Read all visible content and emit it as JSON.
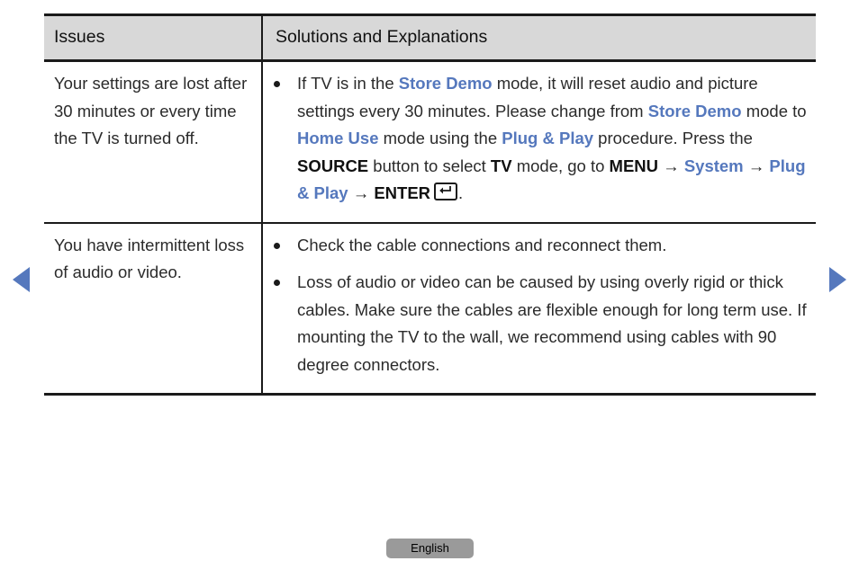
{
  "page": {
    "language_label": "English"
  },
  "navigation": {
    "prev_label": "previous-page",
    "next_label": "next-page"
  },
  "table": {
    "headers": {
      "issues": "Issues",
      "solutions": "Solutions and Explanations"
    },
    "rows": [
      {
        "issue": "Your settings are lost after 30 minutes or every time the TV is turned off.",
        "bullets": [
          {
            "segments": [
              {
                "text": "If TV is in the ",
                "style": "plain"
              },
              {
                "text": "Store Demo",
                "style": "blue"
              },
              {
                "text": " mode, it will reset audio and picture settings every 30 minutes. Please change from ",
                "style": "plain"
              },
              {
                "text": "Store Demo",
                "style": "blue"
              },
              {
                "text": " mode to ",
                "style": "plain"
              },
              {
                "text": "Home Use",
                "style": "blue"
              },
              {
                "text": " mode using the ",
                "style": "plain"
              },
              {
                "text": "Plug & Play",
                "style": "blue"
              },
              {
                "text": " procedure. Press the ",
                "style": "plain"
              },
              {
                "text": "SOURCE",
                "style": "strong"
              },
              {
                "text": " button to select ",
                "style": "plain"
              },
              {
                "text": "TV",
                "style": "strong"
              },
              {
                "text": " mode, go to ",
                "style": "plain"
              },
              {
                "text": "MENU",
                "style": "strong"
              },
              {
                "text": " → ",
                "style": "arrow"
              },
              {
                "text": "System",
                "style": "blue"
              },
              {
                "text": " → ",
                "style": "arrow"
              },
              {
                "text": "Plug & Play",
                "style": "blue"
              },
              {
                "text": " → ",
                "style": "arrow"
              },
              {
                "text": "ENTER",
                "style": "strong"
              },
              {
                "text": "",
                "style": "enter-key-icon"
              },
              {
                "text": ".",
                "style": "plain"
              }
            ]
          }
        ]
      },
      {
        "issue": "You have intermittent loss of audio or video.",
        "bullets": [
          {
            "segments": [
              {
                "text": "Check the cable connections and reconnect them.",
                "style": "plain"
              }
            ]
          },
          {
            "segments": [
              {
                "text": "Loss of audio or video can be caused by using overly rigid or thick cables. Make sure the cables are flexible enough for long term use. If mounting the TV to the wall, we recommend using cables with 90 degree connectors.",
                "style": "plain"
              }
            ]
          }
        ]
      }
    ]
  },
  "colors": {
    "accent_blue": "#5578bd",
    "header_bg": "#d8d8d8",
    "border": "#1a1a1a",
    "text": "#2b2b2b",
    "footer_bg": "#9a9a9a"
  }
}
